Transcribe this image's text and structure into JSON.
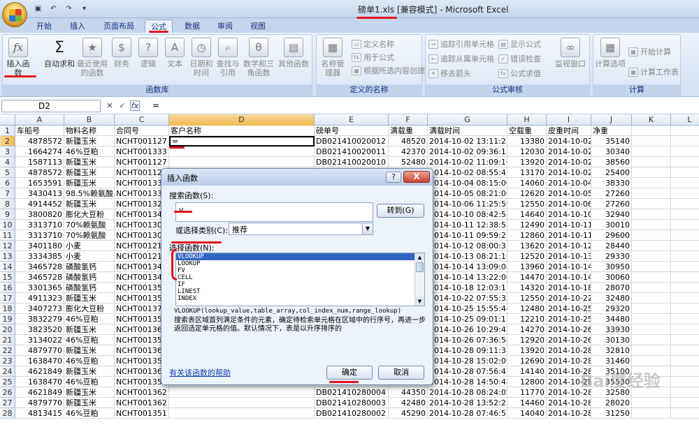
{
  "window": {
    "title": "磅单1.xls  [兼容模式] - Microsoft Excel"
  },
  "tabs": [
    "开始",
    "插入",
    "页面布局",
    "公式",
    "数据",
    "审阅",
    "视图"
  ],
  "ribbon": {
    "function_library": {
      "label": "函数库",
      "insert_function": "插入函数",
      "autosum": "自动求和",
      "recent": "最近使用的函数",
      "financial": "财务",
      "logical": "逻辑",
      "text": "文本",
      "datetime": "日期和时间",
      "lookup": "查找与引用",
      "math": "数学和三角函数",
      "other": "其他函数"
    },
    "defined_names": {
      "label": "定义的名称",
      "name_manager": "名称管理器",
      "define_name": "定义名称",
      "use_in_formula": "用于公式",
      "create_from_selection": "根据所选内容创建"
    },
    "formula_auditing": {
      "label": "公式审核",
      "trace_precedents": "追踪引用单元格",
      "trace_dependents": "追踪从属单元格",
      "remove_arrows": "移去箭头",
      "show_formulas": "显示公式",
      "error_checking": "错误检查",
      "evaluate_formula": "公式求值",
      "watch_window": "监视窗口"
    },
    "calculation": {
      "label": "计算",
      "options": "计算选项",
      "calc_now": "开始计算",
      "calc_sheet": "计算工作表"
    }
  },
  "formula_bar": {
    "name_box": "D2",
    "fx": "fx",
    "formula": "="
  },
  "columns": [
    "A",
    "B",
    "C",
    "D",
    "E",
    "F",
    "G",
    "H",
    "I",
    "J",
    "K",
    "L"
  ],
  "headers": [
    "车船号",
    "物料名称",
    "合同号",
    "客户名称",
    "磅单号",
    "满载重",
    "满载时间",
    "空载重",
    "皮重时间",
    "净重"
  ],
  "rows": [
    [
      "4878572",
      "新疆玉米",
      "NCHT001127",
      "=",
      "DB021410020012",
      "48520",
      "2014-10-02 13:11:25",
      "13380",
      "2014-10-02 1",
      "35140"
    ],
    [
      "1664274",
      "46%豆粕",
      "NCHT001333",
      "",
      "DB021410020011",
      "42370",
      "2014-10-02 09:36:13",
      "12030",
      "2014-10-02 1",
      "30340"
    ],
    [
      "1587113",
      "新疆玉米",
      "NCHT001127",
      "",
      "DB021410020010",
      "52480",
      "2014-10-02 11:09:16",
      "13920",
      "2014-10-02 1",
      "38560"
    ],
    [
      "4878572",
      "新疆玉米",
      "NCHT00112",
      "",
      "",
      "",
      "2014-10-02 08:55:41",
      "13170",
      "2014-10-02 1",
      "25400"
    ],
    [
      "1653591",
      "新疆玉米",
      "NCHT00133",
      "",
      "",
      "",
      "2014-10-04 08:15:00",
      "14060",
      "2014-10-04 1",
      "38330"
    ],
    [
      "3430413",
      "98.5%赖氨酸",
      "NCHT00133",
      "",
      "",
      "",
      "2014-10-05 08:21:06",
      "12620",
      "2014-10-05 1",
      "27260"
    ],
    [
      "4914452",
      "新疆玉米",
      "NCHT00132",
      "",
      "",
      "",
      "2014-10-06 11:25:59",
      "12550",
      "2014-10-06 1",
      "27260"
    ],
    [
      "3800820",
      "膨化大豆粉",
      "NCHT00134",
      "",
      "",
      "",
      "2014-10-10 08:42:53",
      "14640",
      "2014-10-10 1",
      "32940"
    ],
    [
      "3313710",
      "70%赖氨酸",
      "NCHT00130",
      "",
      "",
      "",
      "2014-10-11 12:38:58",
      "12490",
      "2014-10-11 1",
      "30010"
    ],
    [
      "3313710",
      "70%赖氨酸",
      "NCHT00130",
      "",
      "",
      "",
      "2014-10-11 09:59:23",
      "12860",
      "2014-10-11 1",
      "29600"
    ],
    [
      "3401180",
      "小麦",
      "NCHT00121",
      "",
      "",
      "",
      "2014-10-12 08:00:33",
      "13620",
      "2014-10-12 1",
      "28440"
    ],
    [
      "3334385",
      "小麦",
      "NCHT00121",
      "",
      "",
      "",
      "2014-10-13 08:21:16",
      "12520",
      "2014-10-13 1",
      "29330"
    ],
    [
      "3465728",
      "磷酸氢钙",
      "NCHT00134",
      "",
      "",
      "",
      "2014-10-14 13:09:04",
      "13960",
      "2014-10-14 1",
      "30950"
    ],
    [
      "3465728",
      "磷酸氢钙",
      "NCHT00134",
      "",
      "",
      "",
      "2014-10-14 13:22:00",
      "14470",
      "2014-10-14 1",
      "30060"
    ],
    [
      "3301365",
      "磷酸氢钙",
      "NCHT00135",
      "",
      "",
      "",
      "2014-10-18 12:03:11",
      "14320",
      "2014-10-18 1",
      "28070"
    ],
    [
      "4911323",
      "新疆玉米",
      "NCHT00135",
      "",
      "",
      "",
      "2014-10-22 07:55:32",
      "12550",
      "2014-10-22 1",
      "32480"
    ],
    [
      "3407273",
      "膨化大豆粉",
      "NCHT00137",
      "",
      "",
      "",
      "2014-10-25 15:55:44",
      "12480",
      "2014-10-25 1",
      "29320"
    ],
    [
      "3832279",
      "46%豆粕",
      "NCHT00135",
      "",
      "",
      "",
      "2014-10-25 09:01:11",
      "12210",
      "2014-10-25 1",
      "34480"
    ],
    [
      "3823520",
      "新疆玉米",
      "NCHT00136",
      "",
      "",
      "",
      "2014-10-26 10:29:42",
      "14270",
      "2014-10-26 1",
      "33930"
    ],
    [
      "3134022",
      "46%豆粕",
      "NCHT00135",
      "",
      "",
      "",
      "2014-10-26 07:36:58",
      "12920",
      "2014-10-26 0",
      "30130"
    ],
    [
      "4879770",
      "新疆玉米",
      "NCHT00136",
      "",
      "",
      "",
      "2014-10-28 09:11:31",
      "13920",
      "2014-10-28 1",
      "32810"
    ],
    [
      "1638470",
      "46%豆粕",
      "NCHT00135",
      "",
      "",
      "",
      "2014-10-28 15:02:09",
      "12690",
      "2014-10-28 1",
      "31460"
    ],
    [
      "4621849",
      "新疆玉米",
      "NCHT00136",
      "",
      "",
      "",
      "2014-10-28 07:56:47",
      "14140",
      "2014-10-28 1",
      "35100"
    ],
    [
      "1638470",
      "46%豆粕",
      "NCHT00135",
      "",
      "",
      "",
      "2014-10-28 14:50:48",
      "12800",
      "2014-10-28 1",
      "35530"
    ],
    [
      "4621849",
      "新疆玉米",
      "NCHT001362",
      "",
      "DB021410280004",
      "44350",
      "2014-10-28 08:24:02",
      "11770",
      "2014-10-28 1",
      "32580"
    ],
    [
      "4879770",
      "新疆玉米",
      "NCHT001362",
      "",
      "DB021410280003",
      "42480",
      "2014-10-28 13:52:21",
      "14460",
      "2014-10-28 1",
      "28020"
    ],
    [
      "4813415",
      "46%豆粕",
      "NCHT001351",
      "",
      "DB021410280002",
      "45290",
      "2014-10-28 07:46:57",
      "14040",
      "2014-10-28 1",
      "31250"
    ]
  ],
  "dialog": {
    "title": "插入函数",
    "help": "?",
    "close": "X",
    "search_label": "搜索函数(S):",
    "search_value": "v",
    "goto": "转到(G)",
    "category_label": "或选择类别(C):",
    "category_value": "推荐",
    "function_list_label": "选择函数(N):",
    "functions": [
      "VLOOKUP",
      "LOOKUP",
      "FV",
      "CELL",
      "IF",
      "LINEST",
      "INDEX"
    ],
    "signature": "VLOOKUP(lookup_value,table_array,col_index_num,range_lookup)",
    "description": "搜索表区域首列满足条件的元素，确定待检索单元格在区域中的行序号，再进一步返回选定单元格的值。默认情况下，表是以升序排序的",
    "help_link": "有关该函数的帮助",
    "ok": "确定",
    "cancel": "取消"
  },
  "watermark": "Bai度经验"
}
